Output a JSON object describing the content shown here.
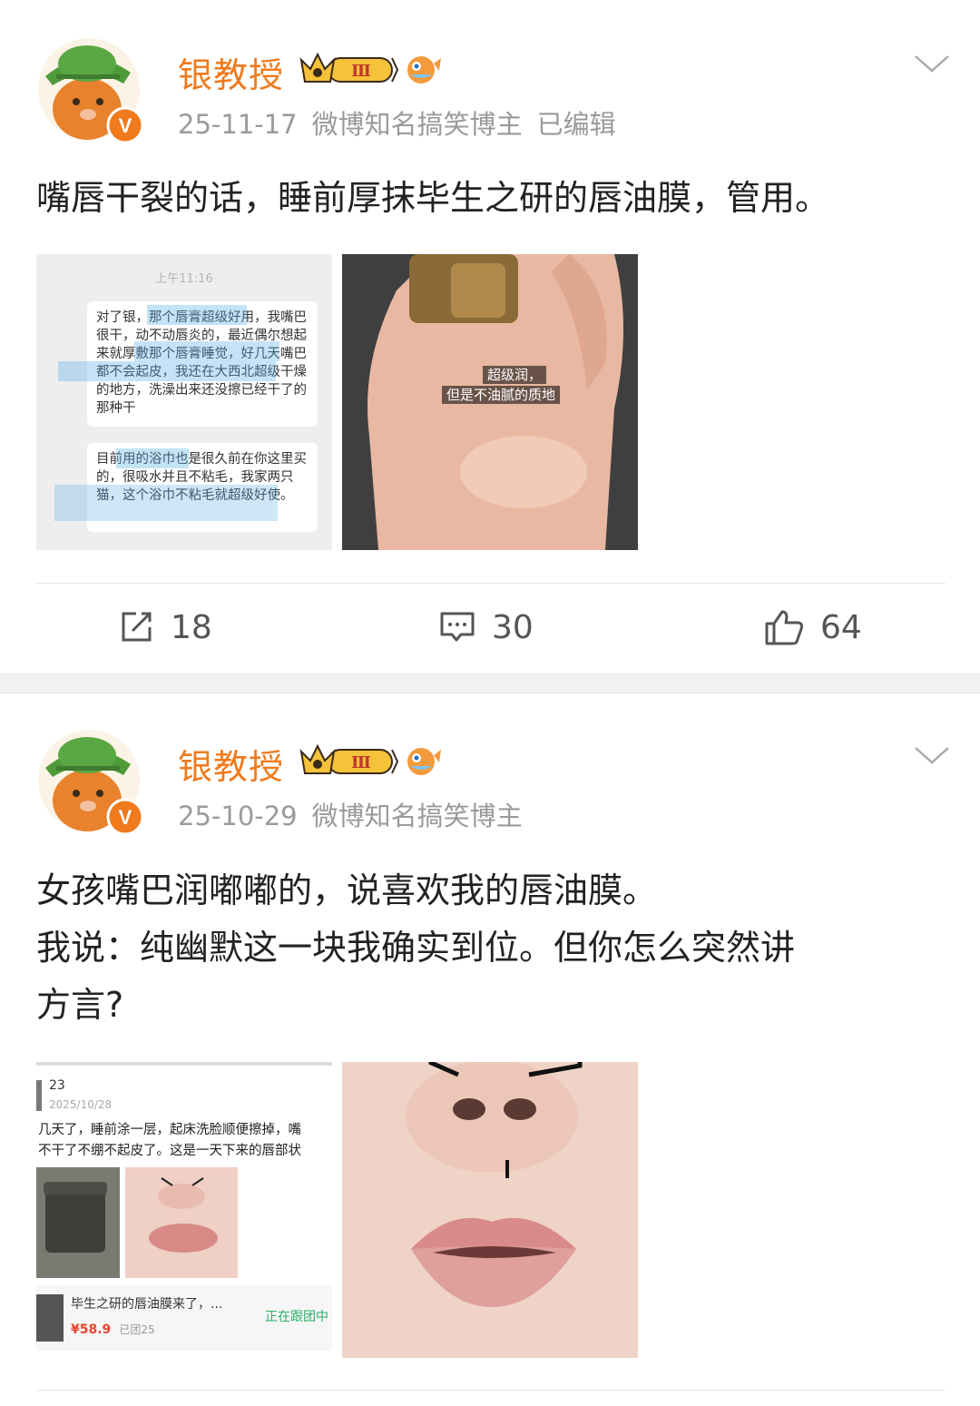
{
  "posts": [
    {
      "author": "银教授",
      "level_badge": "Ⅲ",
      "date": "25-11-17",
      "tag": "微博知名搞笑博主",
      "edited": "已编辑",
      "text_lines": [
        "嘴唇干裂的话，睡前厚抹毕生之研的唇油膜，管用。"
      ],
      "images": {
        "chat": {
          "time": "上午11:16",
          "bubble1": "对了银，那个唇膏超级好用，我嘴巴很干，动不动唇炎的，最近偶尔想起来就厚敷那个唇膏睡觉，好几天嘴巴都不会起皮，我还在大西北超级干燥的地方，洗澡出来还没擦已经干了的那种干",
          "bubble2": "目前用的浴巾也是很久前在你这里买的，很吸水并且不粘毛，我家两只猫，这个浴巾不粘毛就超级好使。"
        },
        "hand": {
          "caption_line1": "超级润，",
          "caption_line2": "但是不油腻的质地"
        }
      },
      "actions": {
        "repost": "18",
        "comment": "30",
        "like": "64"
      }
    },
    {
      "author": "银教授",
      "level_badge": "Ⅲ",
      "date": "25-10-29",
      "tag": "微博知名搞笑博主",
      "text_lines": [
        "女孩嘴巴润嘟嘟的，说喜欢我的唇油膜。",
        "我说：纯幽默这一块我确实到位。但你怎么突然讲",
        "方言?"
      ],
      "images": {
        "review": {
          "user": "23",
          "date": "2025/10/28",
          "line1": "几天了，睡前涂一层，起床洗脸顺便擦掉，嘴",
          "line2": "不干了不绷不起皮了。这是一天下来的唇部状",
          "product_title": "毕生之研的唇油膜来了，...",
          "price": "¥58.9",
          "sold": "已团25",
          "status": "正在跟团中"
        }
      }
    }
  ],
  "colors": {
    "name": "#f07a1c",
    "meta": "#9a9a9a",
    "highlight": "#58afe6",
    "verified": "#f07a1c"
  },
  "icons": [
    "avatar",
    "crown-badge-icon",
    "pufferfish-badge-icon",
    "verified-v-icon",
    "chevron-down-icon",
    "repost-icon",
    "comment-icon",
    "like-icon"
  ]
}
